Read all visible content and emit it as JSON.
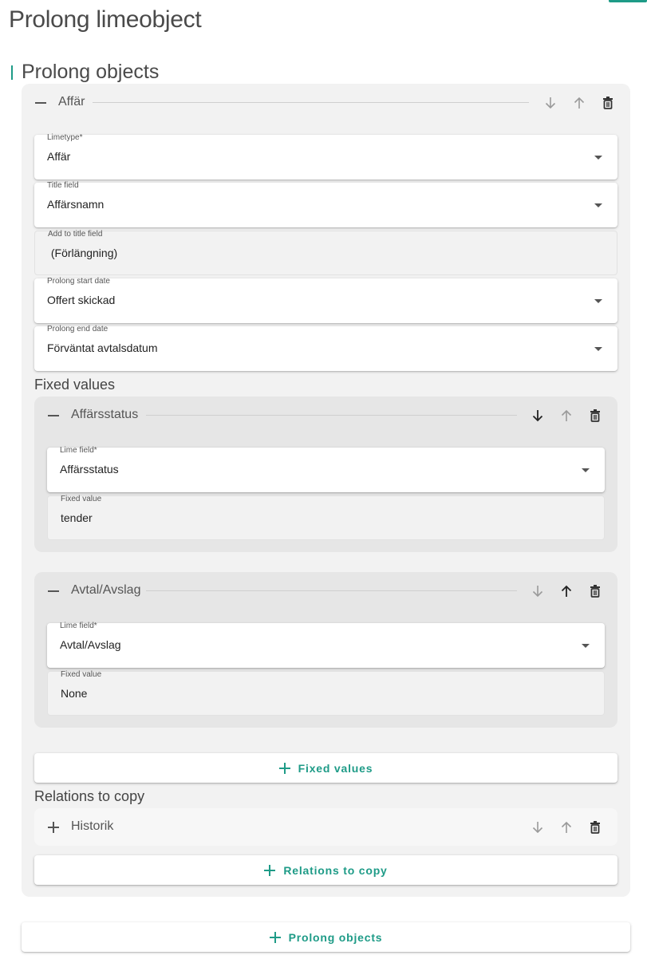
{
  "page": {
    "title": "Prolong limeobject"
  },
  "section": {
    "title": "Prolong objects"
  },
  "object": {
    "name": "Affär",
    "fields": {
      "limetype": {
        "label": "Limetype*",
        "value": "Affär"
      },
      "title_field": {
        "label": "Title field",
        "value": "Affärsnamn"
      },
      "add_to_title": {
        "label": "Add to title field",
        "value": " (Förlängning)"
      },
      "start_date": {
        "label": "Prolong start date",
        "value": "Offert skickad"
      },
      "end_date": {
        "label": "Prolong end date",
        "value": "Förväntat avtalsdatum"
      }
    },
    "fixed_values": {
      "heading": "Fixed values",
      "items": [
        {
          "name": "Affärsstatus",
          "lime_field_label": "Lime field*",
          "lime_field_value": "Affärsstatus",
          "fixed_value_label": "Fixed value",
          "fixed_value": "tender"
        },
        {
          "name": "Avtal/Avslag",
          "lime_field_label": "Lime field*",
          "lime_field_value": "Avtal/Avslag",
          "fixed_value_label": "Fixed value",
          "fixed_value": "None"
        }
      ],
      "add_label": "Fixed values"
    },
    "relations": {
      "heading": "Relations to copy",
      "items": [
        {
          "name": "Historik"
        }
      ],
      "add_label": "Relations to copy"
    }
  },
  "add_prolong_label": "Prolong objects",
  "icons": {
    "move_down": "arrow-down-icon",
    "move_up": "arrow-up-icon",
    "delete": "trash-icon",
    "collapse": "minus-icon",
    "expand": "plus-icon",
    "dropdown": "caret-down-icon",
    "add": "plus-icon"
  },
  "colors": {
    "accent": "#1e9b87",
    "panel": "#f2f2f2",
    "subpanel": "#e6e6e6"
  }
}
